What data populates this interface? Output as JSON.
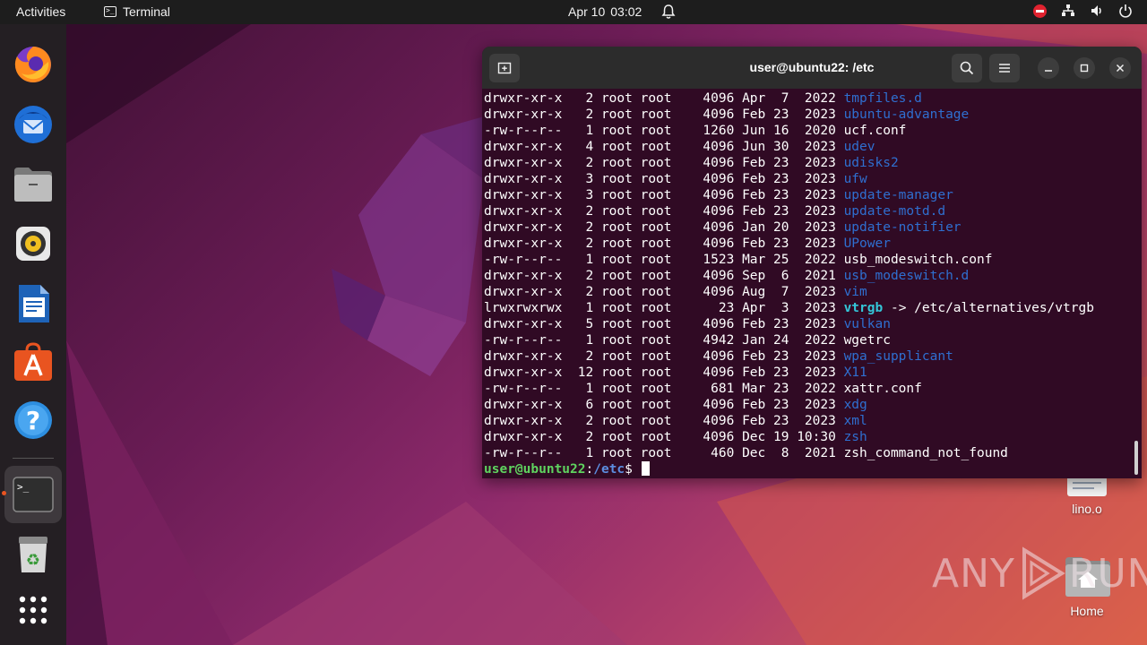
{
  "topbar": {
    "activities": "Activities",
    "app_name": "Terminal",
    "date": "Apr 10",
    "time": "03:02",
    "icons": [
      "notification-bell-icon",
      "stop-icon",
      "network-icon",
      "volume-icon",
      "power-icon"
    ]
  },
  "dock": {
    "items": [
      "firefox",
      "thunderbird",
      "files",
      "rhythmbox",
      "libreoffice-writer",
      "software-center",
      "help",
      "terminal",
      "trash",
      "show-applications"
    ]
  },
  "terminal": {
    "title": "user@ubuntu22: /etc",
    "rows": [
      {
        "perm": "drwxr-xr-x",
        "links": "2",
        "owner": "root",
        "group": "root",
        "size": "4096",
        "month": "Apr",
        "day": "7",
        "year": "2022",
        "name": "tmpfiles.d",
        "type": "dir"
      },
      {
        "perm": "drwxr-xr-x",
        "links": "2",
        "owner": "root",
        "group": "root",
        "size": "4096",
        "month": "Feb",
        "day": "23",
        "year": "2023",
        "name": "ubuntu-advantage",
        "type": "dir"
      },
      {
        "perm": "-rw-r--r--",
        "links": "1",
        "owner": "root",
        "group": "root",
        "size": "1260",
        "month": "Jun",
        "day": "16",
        "year": "2020",
        "name": "ucf.conf",
        "type": "file"
      },
      {
        "perm": "drwxr-xr-x",
        "links": "4",
        "owner": "root",
        "group": "root",
        "size": "4096",
        "month": "Jun",
        "day": "30",
        "year": "2023",
        "name": "udev",
        "type": "dir"
      },
      {
        "perm": "drwxr-xr-x",
        "links": "2",
        "owner": "root",
        "group": "root",
        "size": "4096",
        "month": "Feb",
        "day": "23",
        "year": "2023",
        "name": "udisks2",
        "type": "dir"
      },
      {
        "perm": "drwxr-xr-x",
        "links": "3",
        "owner": "root",
        "group": "root",
        "size": "4096",
        "month": "Feb",
        "day": "23",
        "year": "2023",
        "name": "ufw",
        "type": "dir"
      },
      {
        "perm": "drwxr-xr-x",
        "links": "3",
        "owner": "root",
        "group": "root",
        "size": "4096",
        "month": "Feb",
        "day": "23",
        "year": "2023",
        "name": "update-manager",
        "type": "dir"
      },
      {
        "perm": "drwxr-xr-x",
        "links": "2",
        "owner": "root",
        "group": "root",
        "size": "4096",
        "month": "Feb",
        "day": "23",
        "year": "2023",
        "name": "update-motd.d",
        "type": "dir"
      },
      {
        "perm": "drwxr-xr-x",
        "links": "2",
        "owner": "root",
        "group": "root",
        "size": "4096",
        "month": "Jan",
        "day": "20",
        "year": "2023",
        "name": "update-notifier",
        "type": "dir"
      },
      {
        "perm": "drwxr-xr-x",
        "links": "2",
        "owner": "root",
        "group": "root",
        "size": "4096",
        "month": "Feb",
        "day": "23",
        "year": "2023",
        "name": "UPower",
        "type": "dir"
      },
      {
        "perm": "-rw-r--r--",
        "links": "1",
        "owner": "root",
        "group": "root",
        "size": "1523",
        "month": "Mar",
        "day": "25",
        "year": "2022",
        "name": "usb_modeswitch.conf",
        "type": "file"
      },
      {
        "perm": "drwxr-xr-x",
        "links": "2",
        "owner": "root",
        "group": "root",
        "size": "4096",
        "month": "Sep",
        "day": "6",
        "year": "2021",
        "name": "usb_modeswitch.d",
        "type": "dir"
      },
      {
        "perm": "drwxr-xr-x",
        "links": "2",
        "owner": "root",
        "group": "root",
        "size": "4096",
        "month": "Aug",
        "day": "7",
        "year": "2023",
        "name": "vim",
        "type": "dir"
      },
      {
        "perm": "lrwxrwxrwx",
        "links": "1",
        "owner": "root",
        "group": "root",
        "size": "23",
        "month": "Apr",
        "day": "3",
        "year": "2023",
        "name": "vtrgb",
        "type": "link",
        "target": " -> /etc/alternatives/vtrgb"
      },
      {
        "perm": "drwxr-xr-x",
        "links": "5",
        "owner": "root",
        "group": "root",
        "size": "4096",
        "month": "Feb",
        "day": "23",
        "year": "2023",
        "name": "vulkan",
        "type": "dir"
      },
      {
        "perm": "-rw-r--r--",
        "links": "1",
        "owner": "root",
        "group": "root",
        "size": "4942",
        "month": "Jan",
        "day": "24",
        "year": "2022",
        "name": "wgetrc",
        "type": "file"
      },
      {
        "perm": "drwxr-xr-x",
        "links": "2",
        "owner": "root",
        "group": "root",
        "size": "4096",
        "month": "Feb",
        "day": "23",
        "year": "2023",
        "name": "wpa_supplicant",
        "type": "dir"
      },
      {
        "perm": "drwxr-xr-x",
        "links": "12",
        "owner": "root",
        "group": "root",
        "size": "4096",
        "month": "Feb",
        "day": "23",
        "year": "2023",
        "name": "X11",
        "type": "dir"
      },
      {
        "perm": "-rw-r--r--",
        "links": "1",
        "owner": "root",
        "group": "root",
        "size": "681",
        "month": "Mar",
        "day": "23",
        "year": "2022",
        "name": "xattr.conf",
        "type": "file"
      },
      {
        "perm": "drwxr-xr-x",
        "links": "6",
        "owner": "root",
        "group": "root",
        "size": "4096",
        "month": "Feb",
        "day": "23",
        "year": "2023",
        "name": "xdg",
        "type": "dir"
      },
      {
        "perm": "drwxr-xr-x",
        "links": "2",
        "owner": "root",
        "group": "root",
        "size": "4096",
        "month": "Feb",
        "day": "23",
        "year": "2023",
        "name": "xml",
        "type": "dir"
      },
      {
        "perm": "drwxr-xr-x",
        "links": "2",
        "owner": "root",
        "group": "root",
        "size": "4096",
        "month": "Dec",
        "day": "19",
        "year": "10:30",
        "name": "zsh",
        "type": "dir"
      },
      {
        "perm": "-rw-r--r--",
        "links": "1",
        "owner": "root",
        "group": "root",
        "size": "460",
        "month": "Dec",
        "day": "8",
        "year": "2021",
        "name": "zsh_command_not_found",
        "type": "file"
      }
    ],
    "prompt_user": "user@ubuntu22",
    "prompt_sep": ":",
    "prompt_path": "/etc",
    "prompt_symbol": "$ "
  },
  "desktop": {
    "icons": [
      {
        "label": "lino.o"
      },
      {
        "label": "Home"
      }
    ]
  },
  "watermark": {
    "text_left": "ANY",
    "text_right": "RUN"
  },
  "colors": {
    "terminal_bg": "#300a24",
    "dir": "#2f6fd0",
    "link": "#34c6d8",
    "prompt_user": "#5fd35f",
    "prompt_path": "#5c8de0",
    "accent": "#e95420"
  }
}
